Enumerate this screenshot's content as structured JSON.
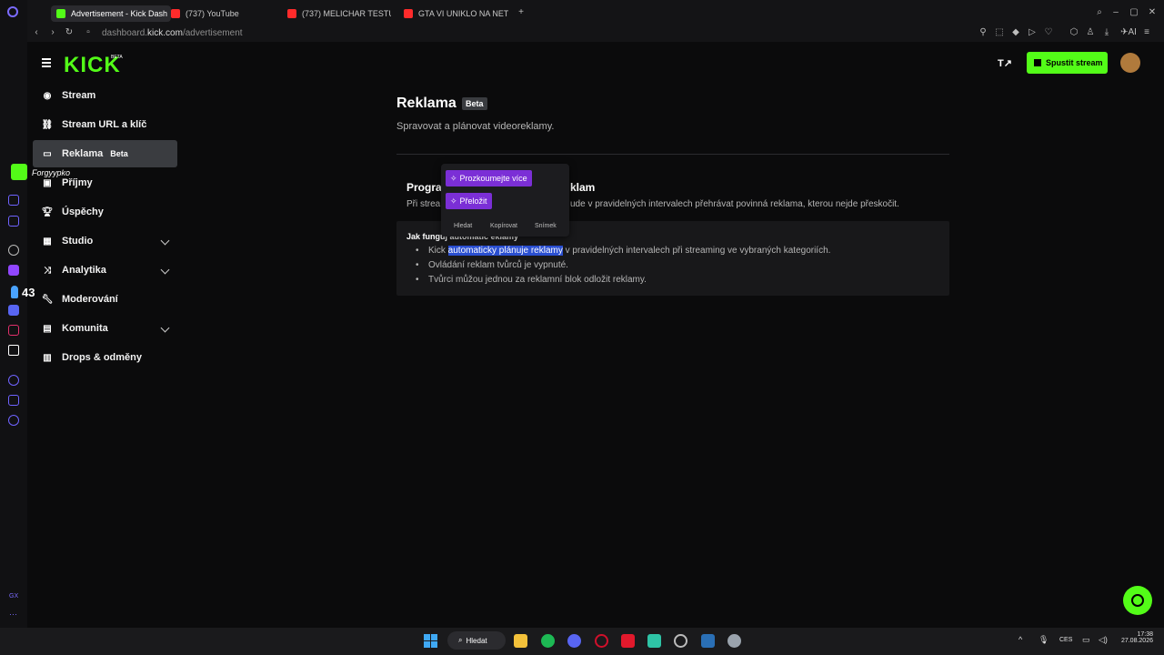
{
  "browser": {
    "tabs": [
      {
        "label": "Advertisement - Kick Dash",
        "active": true
      },
      {
        "label": "(737) YouTube"
      },
      {
        "label": "(737) MELICHAR TESTUJE"
      },
      {
        "label": "GTA VI UNIKLO NA NET! -"
      }
    ],
    "url_prefix": "dashboard.",
    "url_domain": "kick.com",
    "url_path": "/advertisement"
  },
  "overlay": {
    "streamer_tag": "Forgyypko",
    "counter": "43"
  },
  "header": {
    "logo": "KICK",
    "logo_badge": "BETA",
    "stream_button": "Spustit stream"
  },
  "sidebar": {
    "items": [
      {
        "label": "Stream"
      },
      {
        "label": "Stream URL a klíč"
      },
      {
        "label": "Reklama",
        "badge": "Beta"
      },
      {
        "label": "Příjmy"
      },
      {
        "label": "Úspěchy"
      },
      {
        "label": "Studio"
      },
      {
        "label": "Analytika"
      },
      {
        "label": "Moderování"
      },
      {
        "label": "Komunita"
      },
      {
        "label": "Drops & odměny"
      }
    ]
  },
  "main": {
    "title": "Reklama",
    "title_badge": "Beta",
    "subtitle": "Spravovat a plánovat videoreklamy.",
    "card_title_start": "Progra",
    "card_title_end": "klam",
    "card_desc_start": "Při strea",
    "card_desc_end": "ude v pravidelných intervalech přehrávat povinná reklama, kterou nejde přeskočit.",
    "info_title": "Jak funguj    automatic    eklamy",
    "bullets": [
      {
        "pre": "Kick ",
        "highlight": "automaticky plánuje reklamy",
        "post": " v pravidelných intervalech při streaming ve vybraných kategoriích."
      },
      {
        "text": "Ovládání reklam tvůrců je vypnuté."
      },
      {
        "text": "Tvůrci můžou jednou za reklamní blok odložit reklamy."
      }
    ]
  },
  "popup": {
    "explore": "Prozkoumejte více",
    "translate": "Přeložit",
    "actions": [
      "Hledat",
      "Kopírovat",
      "Snímek"
    ]
  },
  "taskbar": {
    "search": "Hledat",
    "lang": "CES",
    "time": "17:38",
    "date": "27.08.2026"
  }
}
